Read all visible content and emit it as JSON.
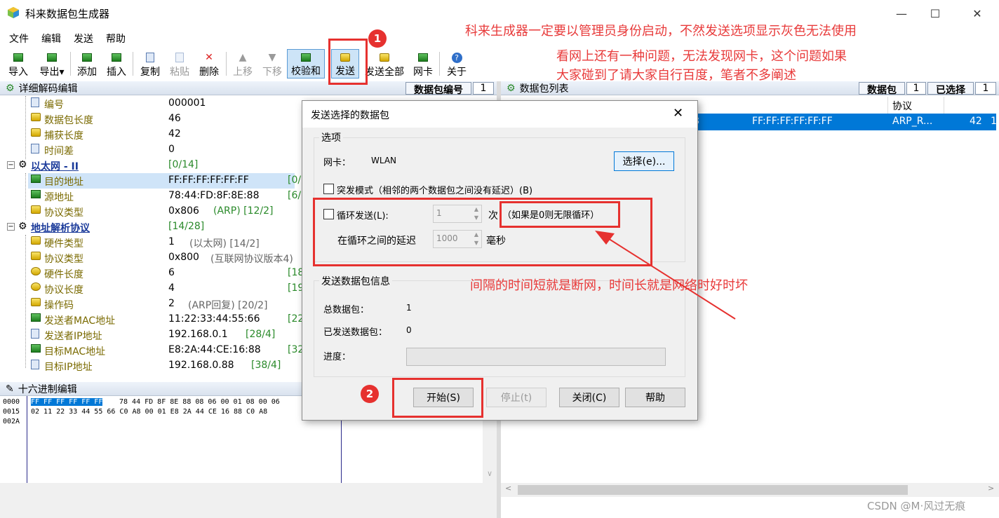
{
  "window": {
    "title": "科来数据包生成器"
  },
  "menu": [
    "文件",
    "编辑",
    "发送",
    "帮助"
  ],
  "toolbar": {
    "import": "导入",
    "export": "导出",
    "add": "添加",
    "insert": "插入",
    "copy": "复制",
    "paste": "粘贴",
    "delete": "删除",
    "up": "上移",
    "down": "下移",
    "checksum": "校验和",
    "send": "发送",
    "send_all": "发送全部",
    "nic": "网卡",
    "about": "关于"
  },
  "left_panel": {
    "title": "详细解码编辑",
    "packet_no_label": "数据包编号",
    "packet_no_value": "1",
    "rows": [
      {
        "name": "编号",
        "value": "000001",
        "extra": ""
      },
      {
        "name": "数据包长度",
        "value": "46",
        "extra": ""
      },
      {
        "name": "捕获长度",
        "value": "42",
        "extra": ""
      },
      {
        "name": "时间差",
        "value": "0",
        "extra": ""
      },
      {
        "name": "以太网 - II",
        "value": "[0/14]",
        "extra": ""
      },
      {
        "name": "目的地址",
        "value": "FF:FF:FF:FF:FF:FF",
        "extra": "[0/"
      },
      {
        "name": "源地址",
        "value": "78:44:FD:8F:8E:88",
        "extra": "[6/"
      },
      {
        "name": "协议类型",
        "value": "0x806",
        "extra": "(ARP)   [12/2]"
      },
      {
        "name": "地址解析协议",
        "value": "[14/28]",
        "extra": ""
      },
      {
        "name": "硬件类型",
        "value": "1",
        "extra": "(以太网)   [14/2]"
      },
      {
        "name": "协议类型",
        "value": "0x800",
        "extra": "(互联网协议版本4)"
      },
      {
        "name": "硬件长度",
        "value": "6",
        "extra": "[18"
      },
      {
        "name": "协议长度",
        "value": "4",
        "extra": "[19"
      },
      {
        "name": "操作码",
        "value": "2",
        "extra": "(ARP回复)   [20/2]"
      },
      {
        "name": "发送者MAC地址",
        "value": "11:22:33:44:55:66",
        "extra": "[22"
      },
      {
        "name": "发送者IP地址",
        "value": "192.168.0.1",
        "extra": "[28/4]"
      },
      {
        "name": "目标MAC地址",
        "value": "E8:2A:44:CE:16:88",
        "extra": "[32"
      },
      {
        "name": "目标IP地址",
        "value": "192.168.0.88",
        "extra": "[38/4]"
      }
    ]
  },
  "hex_panel": {
    "title": "十六进制编辑",
    "offsets": [
      "0000",
      "0015",
      "002A"
    ],
    "line1_sel": "FF FF FF FF FF FF",
    "line1_rest": "78 44 FD 8F 8E 88 08 06 00 01 08 00 06",
    "line2": "02 11 22 33 44 55 66 C0 A8 00 01 E8 2A 44 CE 16 88 C0 A8"
  },
  "right_panel": {
    "title": "数据包列表",
    "packet_label": "数据包",
    "packet_value": "1",
    "selected_label": "已选择",
    "selected_value": "1",
    "col_protocol": "协议",
    "row": {
      "c0": "8",
      "dst": "FF:FF:FF:FF:FF:FF",
      "proto": "ARP_R...",
      "len": "42",
      "c5": "1"
    }
  },
  "dialog": {
    "title": "发送选择的数据包",
    "options_label": "选项",
    "nic_label": "网卡：",
    "nic_value": "WLAN",
    "select_btn": "选择(e)...",
    "burst_label": "突发模式（相邻的两个数据包之间没有延迟）(B)",
    "loop_label": "循环发送(L):",
    "loop_value": "1",
    "times_label": "次",
    "loop_hint": "（如果是0则无限循环）",
    "delay_label": "在循环之间的延迟",
    "delay_value": "1000",
    "ms_label": "毫秒",
    "info_label": "发送数据包信息",
    "total_label": "总数据包：",
    "total_value": "1",
    "sent_label": "已发送数据包：",
    "sent_value": "0",
    "progress_label": "进度：",
    "progress": 0,
    "start_btn": "开始(S)",
    "stop_btn": "停止(t)",
    "close_btn": "关闭(C)",
    "help_btn": "帮助"
  },
  "annotations": {
    "num1": "1",
    "num2": "2",
    "note1": "科来生成器一定要以管理员身份启动，不然发送选项显示灰色无法使用",
    "note2a": "看网上还有一种问题，无法发现网卡，这个问题如果",
    "note2b": "大家碰到了请大家自行百度，笔者不多阐述",
    "note3": "间隔的时间短就是断网，时间长就是网络时好时坏"
  },
  "watermark": "CSDN @M·风过无痕",
  "colors": {
    "annotation_red": "#e6312f",
    "selection_blue": "#0078d7",
    "tree_name_olive": "#7a6a00"
  }
}
